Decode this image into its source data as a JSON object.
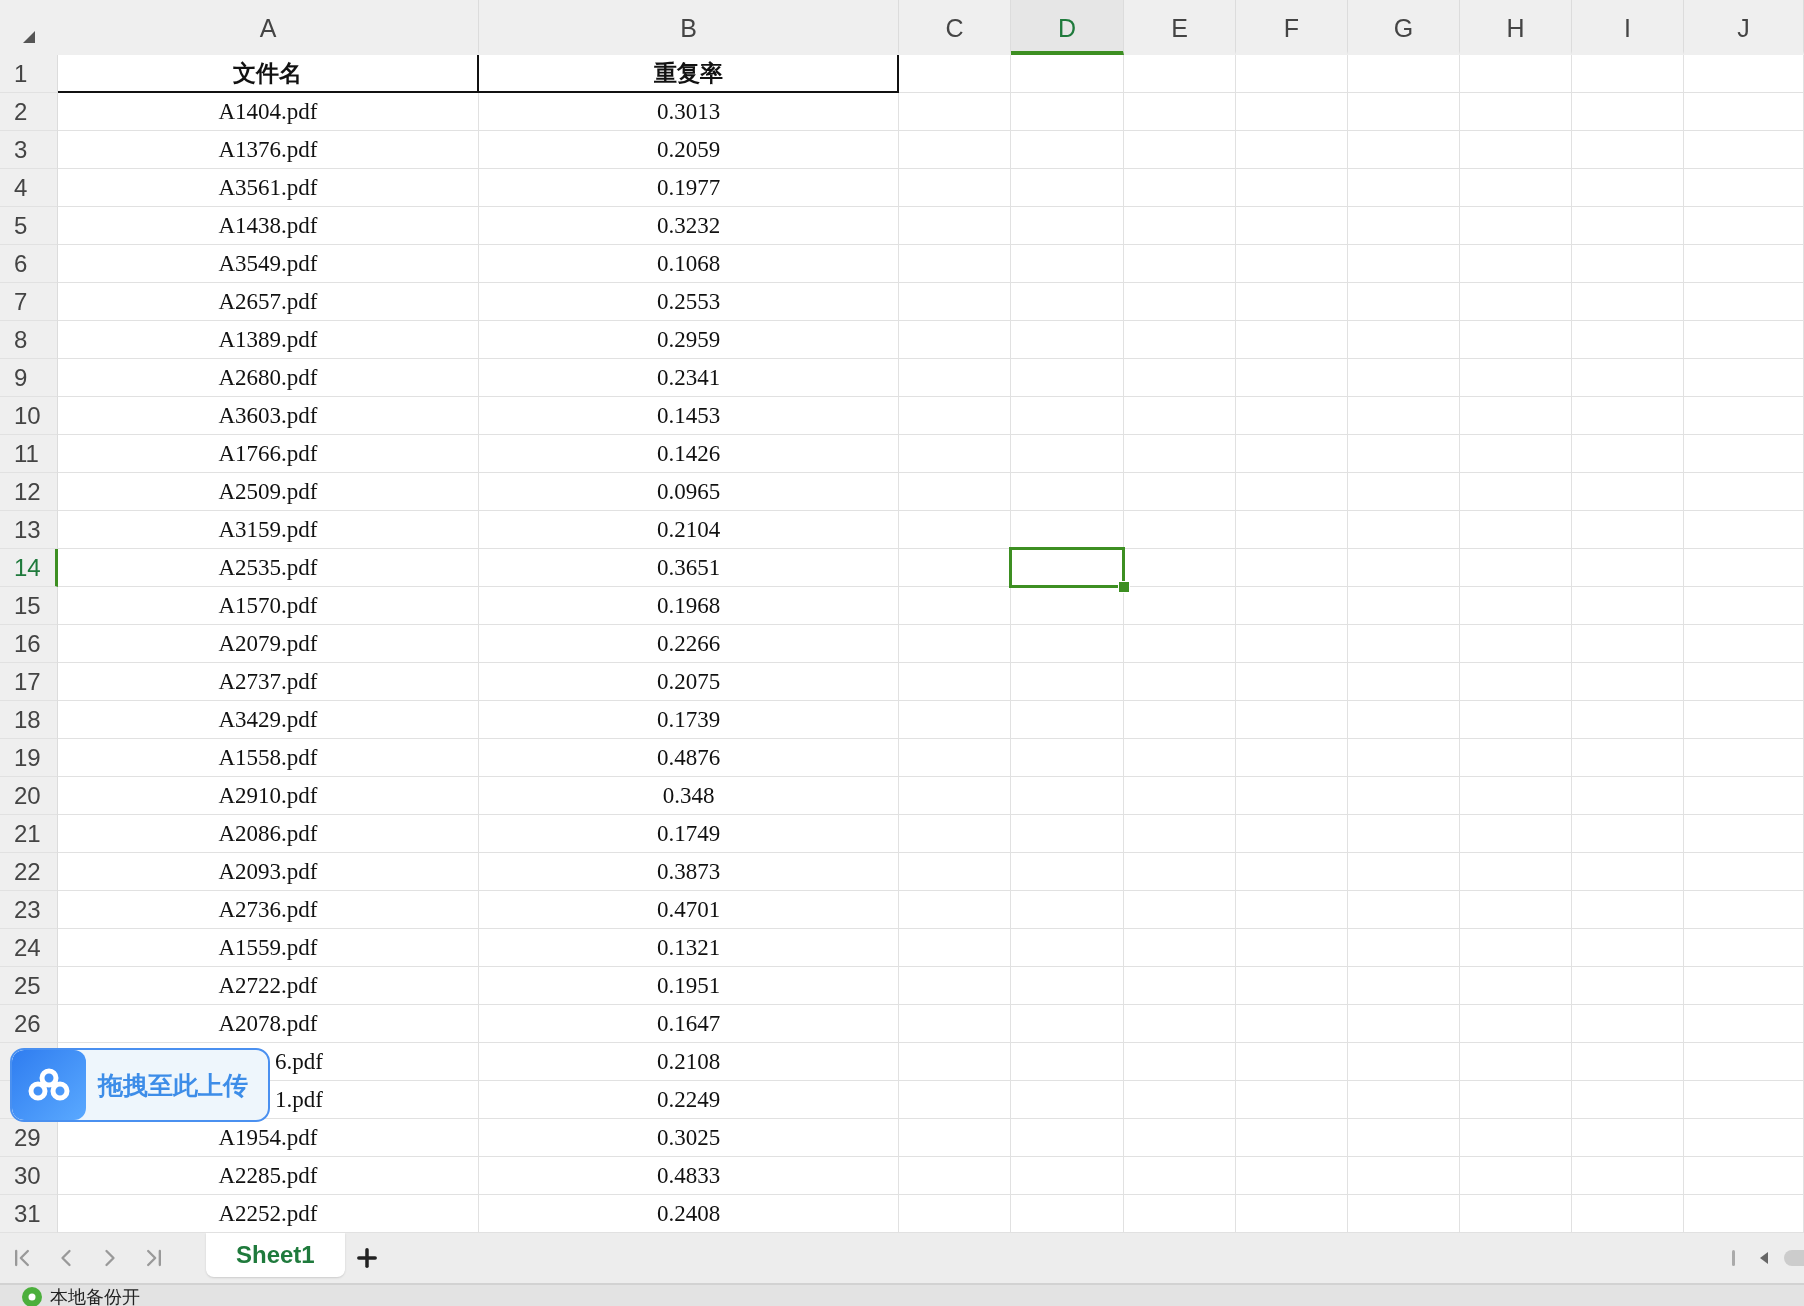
{
  "columns": [
    {
      "label": "A",
      "selected": false
    },
    {
      "label": "B",
      "selected": false
    },
    {
      "label": "C",
      "selected": false
    },
    {
      "label": "D",
      "selected": true
    },
    {
      "label": "E",
      "selected": false
    },
    {
      "label": "F",
      "selected": false
    },
    {
      "label": "G",
      "selected": false
    },
    {
      "label": "H",
      "selected": false
    },
    {
      "label": "I",
      "selected": false
    },
    {
      "label": "J",
      "selected": false
    }
  ],
  "rows": [
    {
      "number": "1",
      "selected": false,
      "kind": "header",
      "cells": [
        "文件名",
        "重复率"
      ]
    },
    {
      "number": "2",
      "selected": false,
      "kind": "data",
      "cells": [
        "A1404.pdf",
        "0.3013"
      ]
    },
    {
      "number": "3",
      "selected": false,
      "kind": "data",
      "cells": [
        "A1376.pdf",
        "0.2059"
      ]
    },
    {
      "number": "4",
      "selected": false,
      "kind": "data",
      "cells": [
        "A3561.pdf",
        "0.1977"
      ]
    },
    {
      "number": "5",
      "selected": false,
      "kind": "data",
      "cells": [
        "A1438.pdf",
        "0.3232"
      ]
    },
    {
      "number": "6",
      "selected": false,
      "kind": "data",
      "cells": [
        "A3549.pdf",
        "0.1068"
      ]
    },
    {
      "number": "7",
      "selected": false,
      "kind": "data",
      "cells": [
        "A2657.pdf",
        "0.2553"
      ]
    },
    {
      "number": "8",
      "selected": false,
      "kind": "data",
      "cells": [
        "A1389.pdf",
        "0.2959"
      ]
    },
    {
      "number": "9",
      "selected": false,
      "kind": "data",
      "cells": [
        "A2680.pdf",
        "0.2341"
      ]
    },
    {
      "number": "10",
      "selected": false,
      "kind": "data",
      "cells": [
        "A3603.pdf",
        "0.1453"
      ]
    },
    {
      "number": "11",
      "selected": false,
      "kind": "data",
      "cells": [
        "A1766.pdf",
        "0.1426"
      ]
    },
    {
      "number": "12",
      "selected": false,
      "kind": "data",
      "cells": [
        "A2509.pdf",
        "0.0965"
      ]
    },
    {
      "number": "13",
      "selected": false,
      "kind": "data",
      "cells": [
        "A3159.pdf",
        "0.2104"
      ]
    },
    {
      "number": "14",
      "selected": true,
      "kind": "data",
      "cells": [
        "A2535.pdf",
        "0.3651"
      ]
    },
    {
      "number": "15",
      "selected": false,
      "kind": "data",
      "cells": [
        "A1570.pdf",
        "0.1968"
      ]
    },
    {
      "number": "16",
      "selected": false,
      "kind": "data",
      "cells": [
        "A2079.pdf",
        "0.2266"
      ]
    },
    {
      "number": "17",
      "selected": false,
      "kind": "data",
      "cells": [
        "A2737.pdf",
        "0.2075"
      ]
    },
    {
      "number": "18",
      "selected": false,
      "kind": "data",
      "cells": [
        "A3429.pdf",
        "0.1739"
      ]
    },
    {
      "number": "19",
      "selected": false,
      "kind": "data",
      "cells": [
        "A1558.pdf",
        "0.4876"
      ]
    },
    {
      "number": "20",
      "selected": false,
      "kind": "data",
      "cells": [
        "A2910.pdf",
        "0.348"
      ]
    },
    {
      "number": "21",
      "selected": false,
      "kind": "data",
      "cells": [
        "A2086.pdf",
        "0.1749"
      ]
    },
    {
      "number": "22",
      "selected": false,
      "kind": "data",
      "cells": [
        "A2093.pdf",
        "0.3873"
      ]
    },
    {
      "number": "23",
      "selected": false,
      "kind": "data",
      "cells": [
        "A2736.pdf",
        "0.4701"
      ]
    },
    {
      "number": "24",
      "selected": false,
      "kind": "data",
      "cells": [
        "A1559.pdf",
        "0.1321"
      ]
    },
    {
      "number": "25",
      "selected": false,
      "kind": "data",
      "cells": [
        "A2722.pdf",
        "0.1951"
      ]
    },
    {
      "number": "26",
      "selected": false,
      "kind": "data",
      "cells": [
        "A2078.pdf",
        "0.1647"
      ]
    },
    {
      "kind": "partial",
      "cells": [
        "6.pdf",
        "0.2108"
      ]
    },
    {
      "kind": "partial",
      "cells": [
        "1.pdf",
        "0.2249"
      ]
    },
    {
      "number": "29",
      "selected": false,
      "kind": "data",
      "cells": [
        "A1954.pdf",
        "0.3025"
      ]
    },
    {
      "number": "30",
      "selected": false,
      "kind": "data",
      "cells": [
        "A2285.pdf",
        "0.4833"
      ]
    },
    {
      "number": "31",
      "selected": false,
      "kind": "data",
      "cells": [
        "A2252.pdf",
        "0.2408"
      ]
    }
  ],
  "upload_badge": {
    "label": "拖拽至此上传"
  },
  "sheets": [
    {
      "label": "Sheet1",
      "selected": true
    }
  ],
  "status_bar": {
    "label": "本地备份开"
  }
}
